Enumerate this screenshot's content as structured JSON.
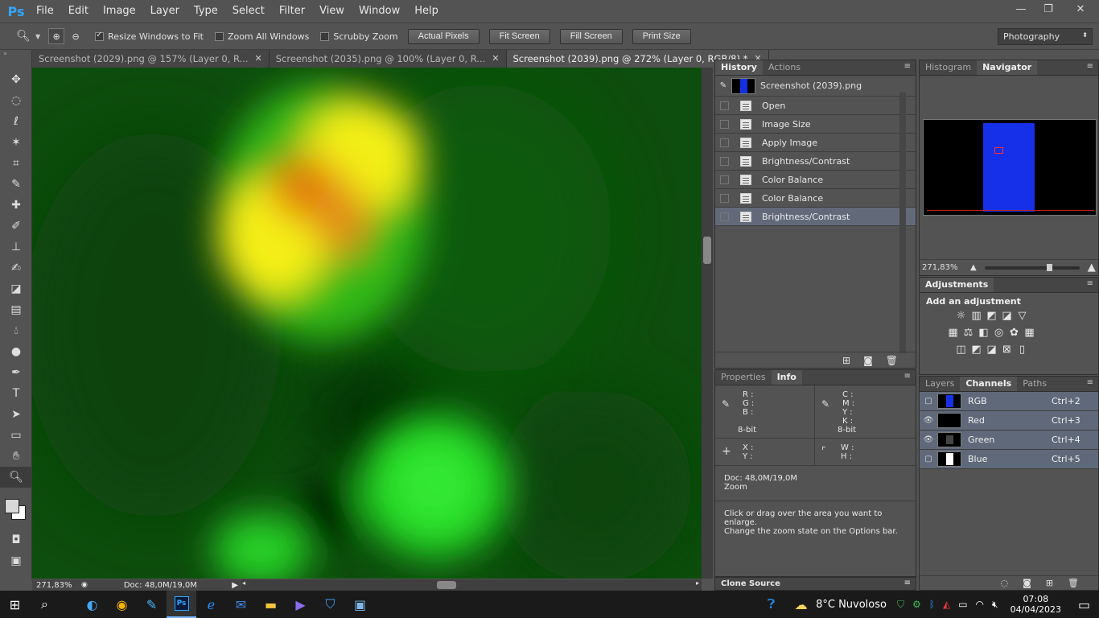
{
  "app": {
    "logo": "Ps"
  },
  "menu": [
    "File",
    "Edit",
    "Image",
    "Layer",
    "Type",
    "Select",
    "Filter",
    "View",
    "Window",
    "Help"
  ],
  "window_controls": {
    "minimize": "—",
    "restore": "❐",
    "close": "✕"
  },
  "options": {
    "resize_windows": "Resize Windows to Fit",
    "resize_checked": true,
    "zoom_all": "Zoom All Windows",
    "zoom_all_checked": false,
    "scrubby": "Scrubby Zoom",
    "scrubby_checked": false,
    "buttons": [
      "Actual Pixels",
      "Fit Screen",
      "Fill Screen",
      "Print Size"
    ],
    "workspace": "Photography"
  },
  "tabs": [
    {
      "label": "Screenshot (2029).png @ 157% (Layer 0, R...",
      "active": false
    },
    {
      "label": "Screenshot (2035).png @ 100% (Layer 0, R...",
      "active": false
    },
    {
      "label": "Screenshot (2039).png @ 272% (Layer 0, RGB/8) *",
      "active": true
    }
  ],
  "status": {
    "zoom": "271,83%",
    "doc": "Doc: 48,0M/19,0M"
  },
  "history": {
    "tabs": [
      "History",
      "Actions"
    ],
    "snapshot": "Screenshot (2039).png",
    "items": [
      "Open",
      "Image Size",
      "Apply Image",
      "Brightness/Contrast",
      "Color Balance",
      "Color Balance",
      "Brightness/Contrast"
    ],
    "selected_index": 6
  },
  "navigator": {
    "tabs": [
      "Histogram",
      "Navigator"
    ],
    "zoom": "271,83%",
    "zoom_slider_fraction": 0.7
  },
  "info": {
    "tabs": [
      "Properties",
      "Info"
    ],
    "rgb": [
      "R :",
      "G :",
      "B :"
    ],
    "cmyk": [
      "C :",
      "M :",
      "Y :",
      "K :"
    ],
    "bit_left": "8-bit",
    "bit_right": "8-bit",
    "xy": [
      "X :",
      "Y :"
    ],
    "wh": [
      "W :",
      "H :"
    ],
    "doc": "Doc: 48,0M/19,0M",
    "tool": "Zoom",
    "hint1": "Click or drag over the area you want to enlarge.",
    "hint2": "Change the zoom state on the Options bar."
  },
  "clone_source": "Clone Source",
  "adjustments": {
    "title": "Adjustments",
    "subtitle": "Add an adjustment"
  },
  "channels": {
    "tabs": [
      "Layers",
      "Channels",
      "Paths"
    ],
    "items": [
      {
        "name": "RGB",
        "shortcut": "Ctrl+2",
        "visible": false
      },
      {
        "name": "Red",
        "shortcut": "Ctrl+3",
        "visible": true
      },
      {
        "name": "Green",
        "shortcut": "Ctrl+4",
        "visible": true
      },
      {
        "name": "Blue",
        "shortcut": "Ctrl+5",
        "visible": false
      }
    ]
  },
  "taskbar": {
    "weather": "8°C  Nuvoloso",
    "time": "07:08",
    "date": "04/04/2023"
  },
  "colors": {
    "accent": "#31a8ff",
    "canvas_green": "#0b4a0b",
    "selected_row": "#626a7a"
  }
}
